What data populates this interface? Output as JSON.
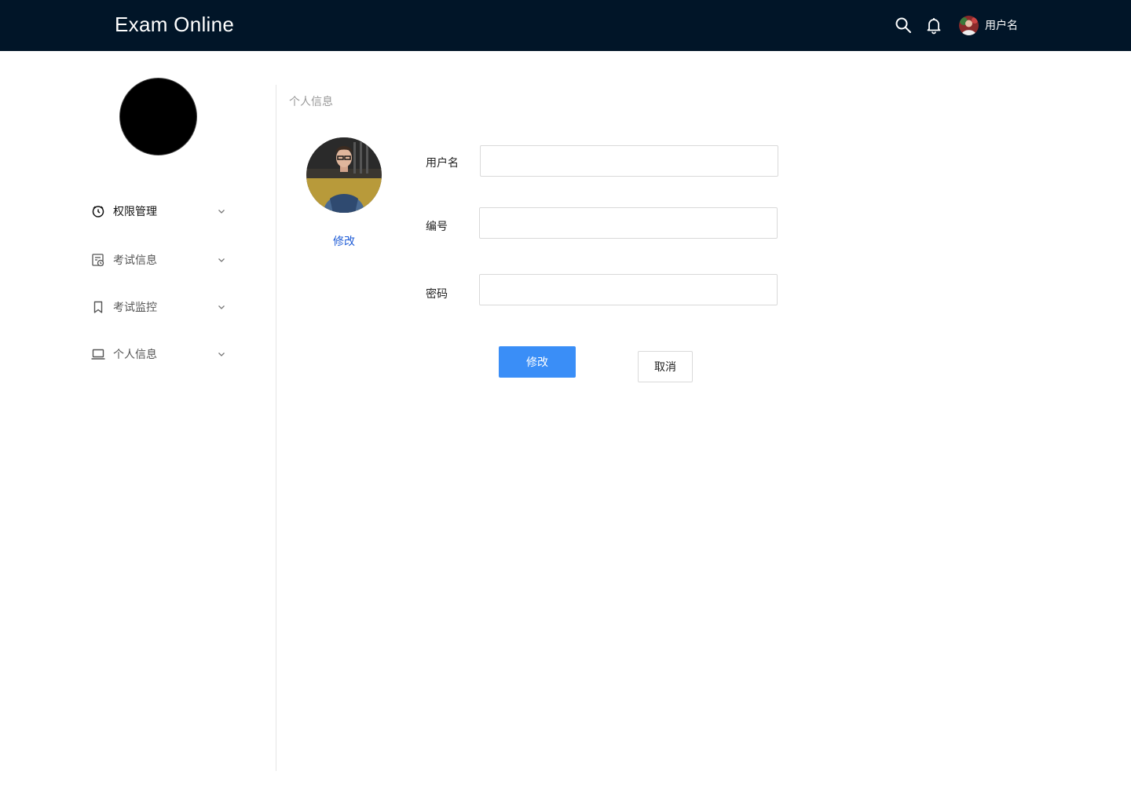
{
  "header": {
    "brand": "Exam Online",
    "username": "用户名",
    "icons": [
      "search-icon",
      "bell-icon"
    ]
  },
  "sidebar": {
    "items": [
      {
        "label": "权限管理",
        "icon": "permission-icon",
        "active": true
      },
      {
        "label": "考试信息",
        "icon": "exam-info-icon",
        "active": false
      },
      {
        "label": "考试监控",
        "icon": "bookmark-icon",
        "active": false
      },
      {
        "label": "个人信息",
        "icon": "laptop-icon",
        "active": false
      }
    ]
  },
  "main": {
    "breadcrumb": "个人信息",
    "avatar_edit_label": "修改",
    "form": {
      "username_label": "用户名",
      "username_value": "",
      "id_label": "编号",
      "id_value": "",
      "password_label": "密码",
      "password_value": ""
    },
    "submit_label": "修改",
    "cancel_label": "取消"
  },
  "colors": {
    "header_bg": "#011528",
    "primary": "#3a8ef7",
    "link": "#1e5bd6"
  }
}
